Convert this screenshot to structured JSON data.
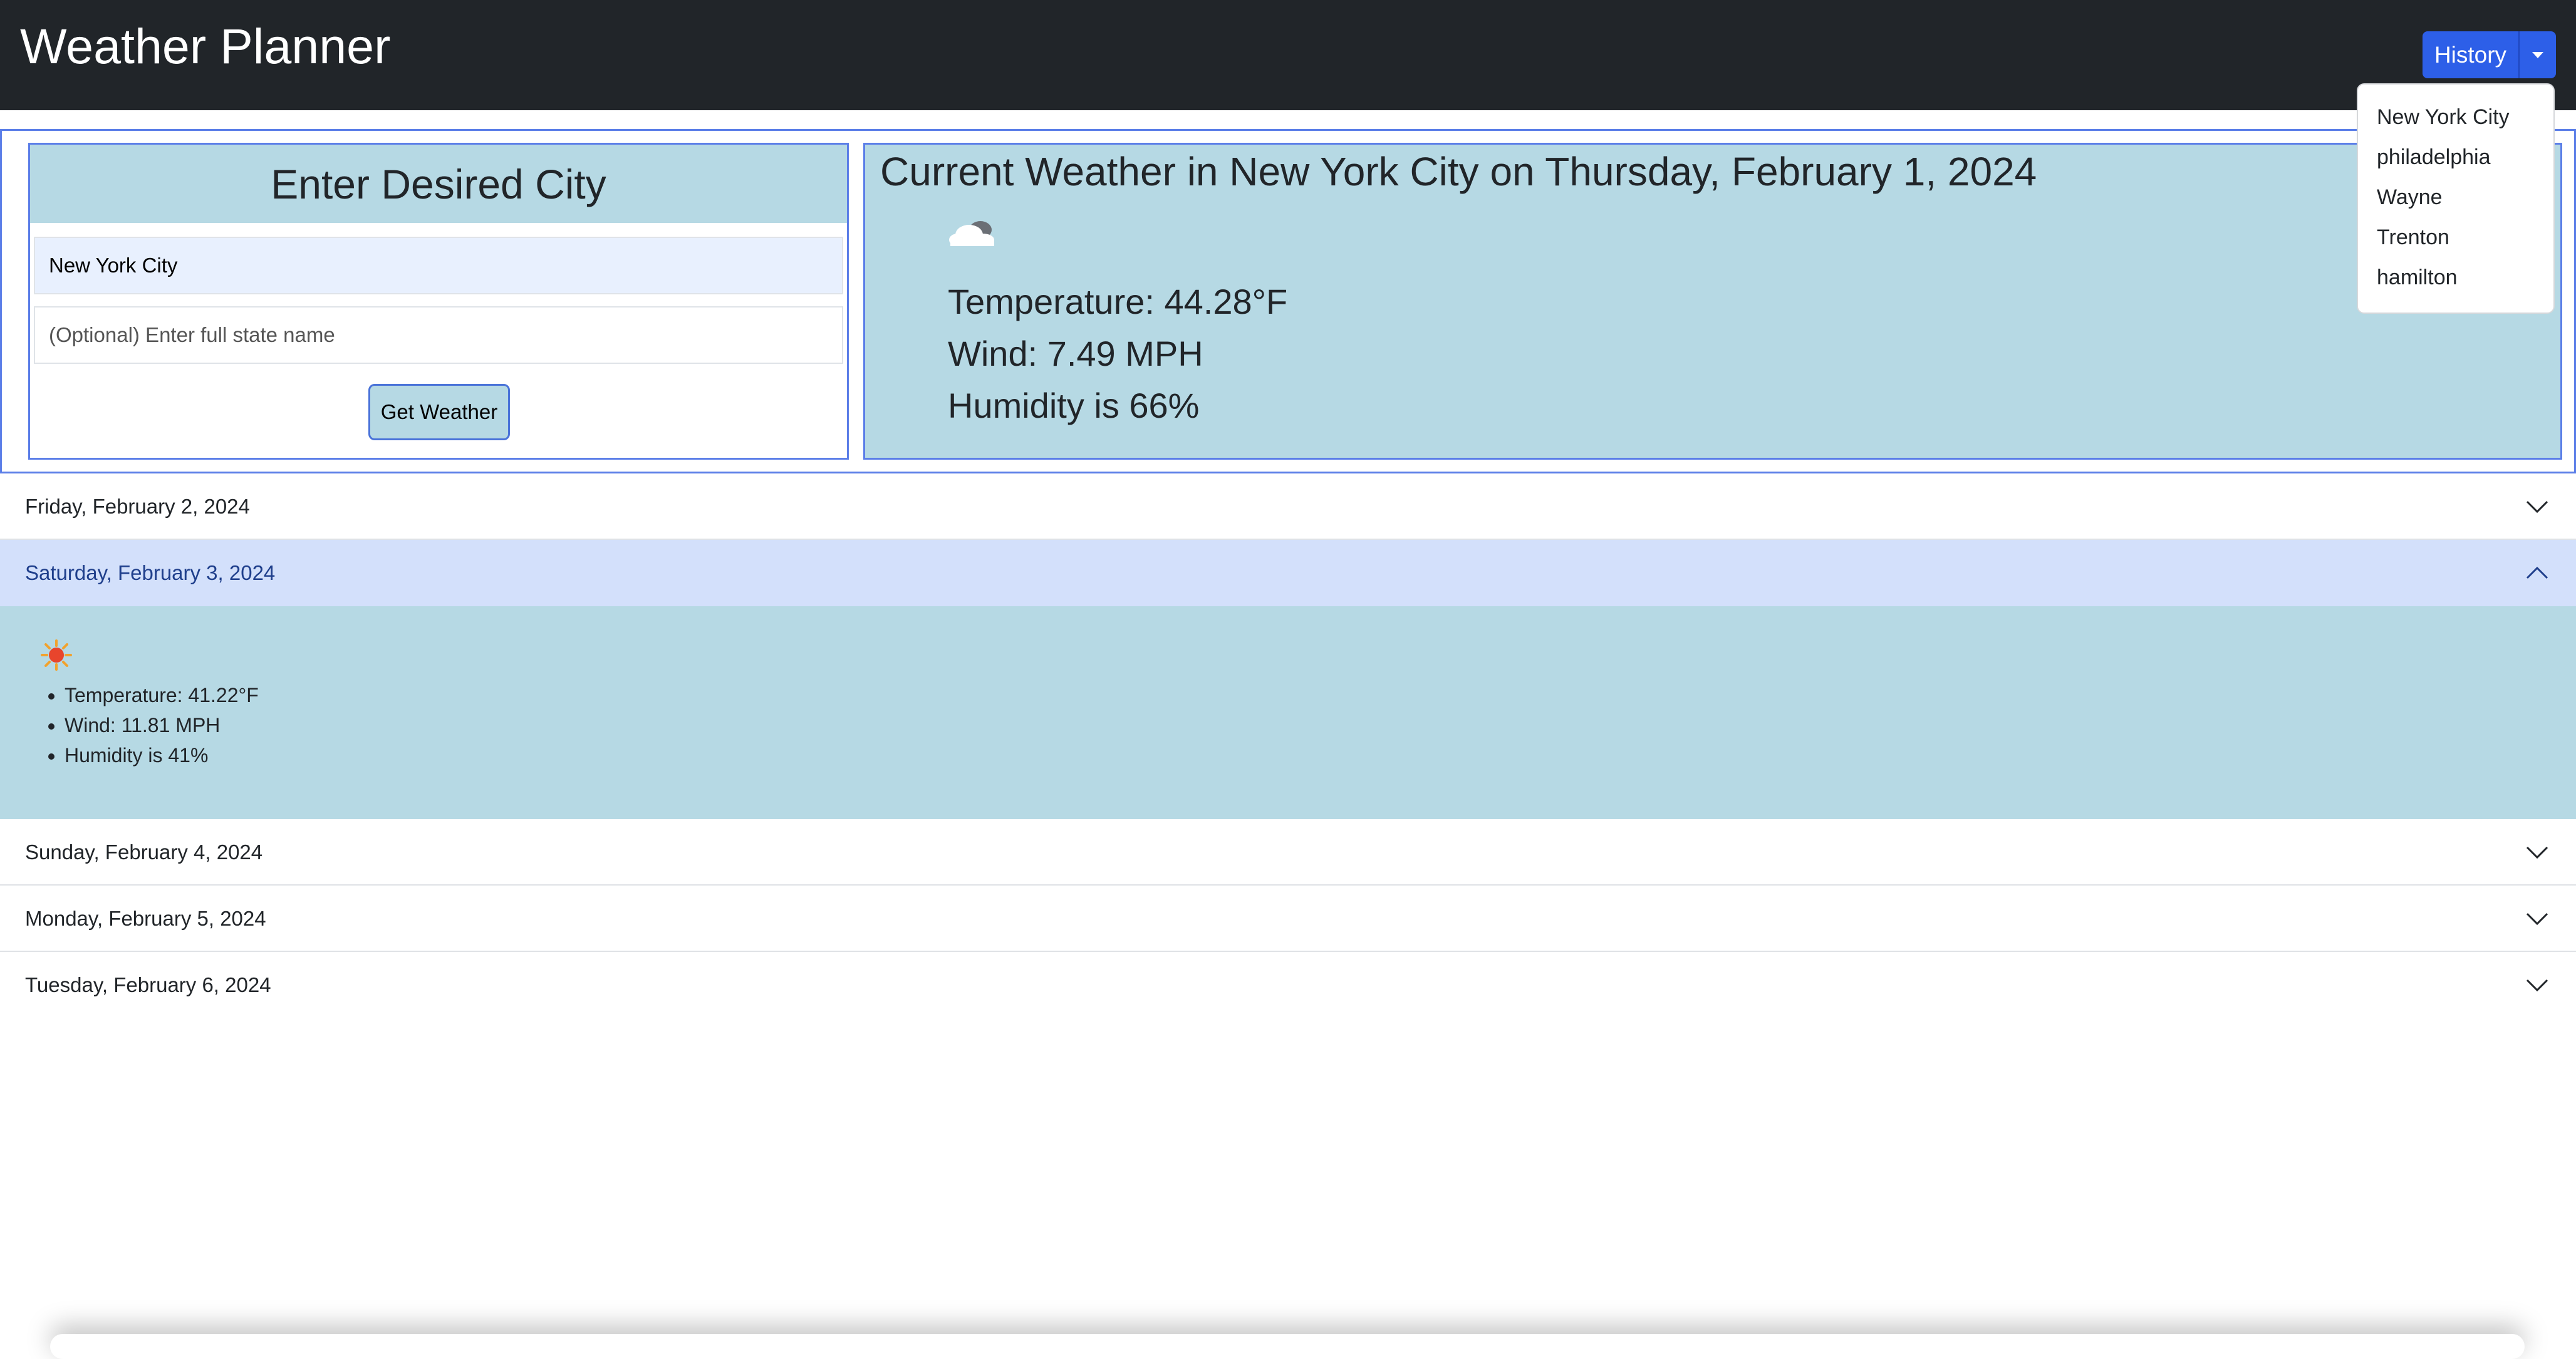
{
  "header": {
    "title": "Weather Planner"
  },
  "history": {
    "button_label": "History",
    "items": [
      "New York City",
      "philadelphia",
      "Wayne",
      "Trenton",
      "hamilton"
    ]
  },
  "search": {
    "heading": "Enter Desired City",
    "city_value": "New York City",
    "state_placeholder": "(Optional) Enter full state name",
    "button_label": "Get Weather"
  },
  "current": {
    "title": "Current Weather in New York City on Thursday, February 1, 2024",
    "icon": "cloud-icon",
    "temperature": "Temperature: 44.28°F",
    "wind": "Wind: 7.49 MPH",
    "humidity": "Humidity is 66%"
  },
  "forecast": [
    {
      "date": "Friday, February 2, 2024",
      "expanded": false
    },
    {
      "date": "Saturday, February 3, 2024",
      "expanded": true,
      "icon": "sun-icon",
      "temperature": "Temperature: 41.22°F",
      "wind": "Wind: 11.81 MPH",
      "humidity": "Humidity is 41%"
    },
    {
      "date": "Sunday, February 4, 2024",
      "expanded": false
    },
    {
      "date": "Monday, February 5, 2024",
      "expanded": false
    },
    {
      "date": "Tuesday, February 6, 2024",
      "expanded": false
    }
  ],
  "colors": {
    "navbar": "#212529",
    "primary": "#2d5fe8",
    "card_bg": "#b6d9e4",
    "accordion_open": "#d3e0fb",
    "border_accent": "#5b7ee8"
  }
}
